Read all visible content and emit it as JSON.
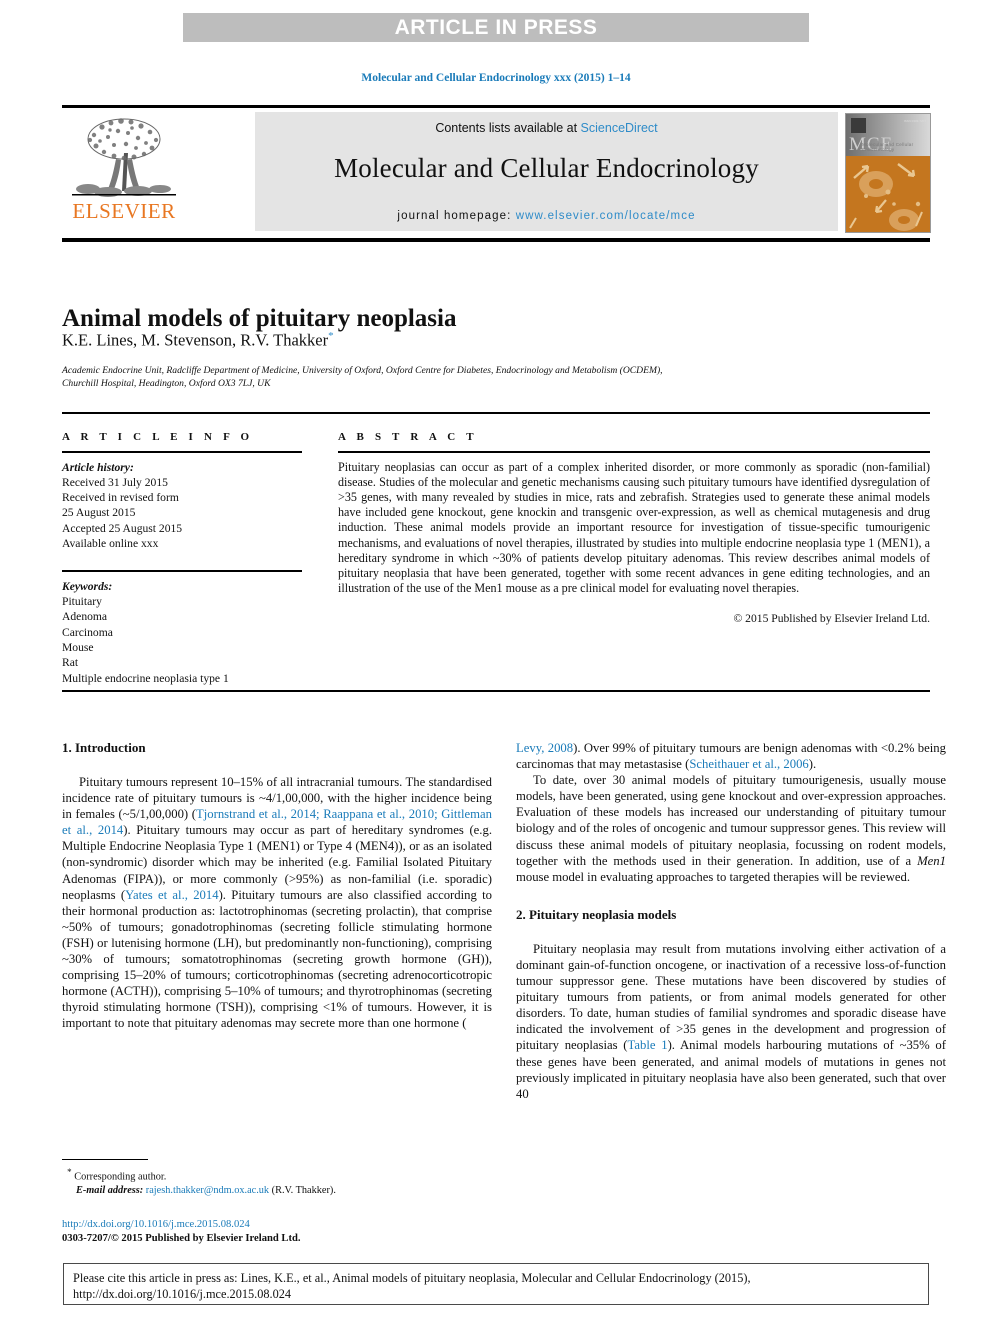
{
  "banner": {
    "text": "ARTICLE IN PRESS"
  },
  "journal_ref": "Molecular and Cellular Endocrinology xxx (2015) 1–14",
  "masthead": {
    "contents_prefix": "Contents lists available at ",
    "sciencedirect": "ScienceDirect",
    "journal_title": "Molecular and Cellular Endocrinology",
    "homepage_label": "journal homepage:",
    "homepage_url": "www.elsevier.com/locate/mce",
    "publisher_wordmark": "ELSEVIER",
    "cover_mce": "MCE",
    "cover_sub": "Molecular and Cellular Endocrinology",
    "cover_corner_text": "ISSN 0303-7207"
  },
  "article": {
    "title": "Animal models of pituitary neoplasia",
    "authors": "K.E. Lines, M. Stevenson, R.V. Thakker",
    "corresponding_marker": "*",
    "affiliation_line1": "Academic Endocrine Unit, Radcliffe Department of Medicine, University of Oxford, Oxford Centre for Diabetes, Endocrinology and Metabolism (OCDEM),",
    "affiliation_line2": "Churchill Hospital, Headington, Oxford OX3 7LJ, UK"
  },
  "article_info": {
    "heading": "A R T I C L E   I N F O",
    "history_label": "Article history:",
    "history": [
      "Received 31 July 2015",
      "Received in revised form",
      "25 August 2015",
      "Accepted 25 August 2015",
      "Available online xxx"
    ],
    "keywords_label": "Keywords:",
    "keywords": [
      "Pituitary",
      "Adenoma",
      "Carcinoma",
      "Mouse",
      "Rat",
      "Multiple endocrine neoplasia type 1"
    ]
  },
  "abstract": {
    "heading": "A B S T R A C T",
    "body": "Pituitary neoplasias can occur as part of a complex inherited disorder, or more commonly as sporadic (non-familial) disease. Studies of the molecular and genetic mechanisms causing such pituitary tumours have identified dysregulation of >35 genes, with many revealed by studies in mice, rats and zebrafish. Strategies used to generate these animal models have included gene knockout, gene knockin and transgenic over-expression, as well as chemical mutagenesis and drug induction. These animal models provide an important resource for investigation of tissue-specific tumourigenic mechanisms, and evaluations of novel therapies, illustrated by studies into multiple endocrine neoplasia type 1 (MEN1), a hereditary syndrome in which ~30% of patients develop pituitary adenomas. This review describes animal models of pituitary neoplasia that have been generated, together with some recent advances in gene editing technologies, and an illustration of the use of the Men1 mouse as a pre clinical model for evaluating novel therapies.",
    "copyright": "© 2015 Published by Elsevier Ireland Ltd."
  },
  "body": {
    "section1_heading": "1.  Introduction",
    "section1_para1_a": "Pituitary tumours represent 10–15% of all intracranial tumours. The standardised incidence rate of pituitary tumours is ~4/1,00,000, with the higher incidence being in females (~5/1,00,000) (",
    "section1_para1_ref1": "Tjornstrand et al., 2014; Raappana et al., 2010; Gittleman et al., 2014",
    "section1_para1_b": "). Pituitary tumours may occur as part of hereditary syndromes (e.g. Multiple Endocrine Neoplasia Type 1 (MEN1) or Type 4 (MEN4)), or as an isolated (non-syndromic) disorder which may be inherited (e.g. Familial Isolated Pituitary Adenomas (FIPA)), or more commonly (>95%) as non-familial (i.e. sporadic) neoplasms (",
    "section1_para1_ref2": "Yates et al., 2014",
    "section1_para1_c": "). Pituitary tumours are also classified according to their hormonal production as: lactotrophinomas (secreting prolactin), that comprise ~50% of tumours; gonadotrophinomas (secreting follicle stimulating hormone (FSH) or lutenising hormone (LH), but predominantly non-functioning), comprising ~30% of tumours; somatotrophinomas (secreting growth hormone (GH)), comprising 15–20% of tumours; corticotrophinomas (secreting adrenocorticotropic hormone (ACTH)), comprising 5–10% of tumours; and thyrotrophinomas (secreting thyroid stimulating hormone (TSH)), comprising <1% of tumours. However, it is important to note that pituitary adenomas may secrete more than one hormone (",
    "section1_para1_ref3": "Levy, 2008",
    "section1_para1_d": "). Over 99% of pituitary tumours are benign adenomas with <0.2% being carcinomas that may metastasise (",
    "section1_para1_ref4": "Scheithauer et al., 2006",
    "section1_para1_e": ").",
    "section1_para2": "To date, over 30 animal models of pituitary tumourigenesis, usually mouse models, have been generated, using gene knockout and over-expression approaches. Evaluation of these models has increased our understanding of pituitary tumour biology and of the roles of oncogenic and tumour suppressor genes. This review will discuss these animal models of pituitary neoplasia, focussing on rodent models, together with the methods used in their generation. In addition, use of a ",
    "section1_para2_italic": "Men1",
    "section1_para2_b": " mouse model in evaluating approaches to targeted therapies will be reviewed.",
    "section2_heading": "2.  Pituitary neoplasia models",
    "section2_para1_a": "Pituitary neoplasia may result from mutations involving either activation of a dominant gain-of-function oncogene, or inactivation of a recessive loss-of-function tumour suppressor gene. These mutations have been discovered by studies of pituitary tumours from patients, or from animal models generated for other disorders. To date, human studies of familial syndromes and sporadic disease have indicated the involvement of >35 genes in the development and progression of pituitary neoplasias (",
    "section2_para1_ref": "Table 1",
    "section2_para1_b": "). Animal models harbouring mutations of ~35% of these genes have been generated, and animal models of mutations in genes not previously implicated in pituitary neoplasia have also been generated, such that over 40"
  },
  "footnote": {
    "star": "*",
    "corresponding": "Corresponding author.",
    "email_label": "E-mail address:",
    "email": "rajesh.thakker@ndm.ox.ac.uk",
    "email_owner": "(R.V. Thakker).",
    "doi_url": "http://dx.doi.org/10.1016/j.mce.2015.08.024",
    "issn_line": "0303-7207/© 2015 Published by Elsevier Ireland Ltd."
  },
  "citation_box": {
    "text": "Please cite this article in press as: Lines, K.E., et al., Animal models of pituitary neoplasia, Molecular and Cellular Endocrinology (2015), http://dx.doi.org/10.1016/j.mce.2015.08.024"
  },
  "colors": {
    "link": "#1a7bb9",
    "elsevier_orange": "#E87722",
    "banner_grey": "#bdbdbd"
  }
}
